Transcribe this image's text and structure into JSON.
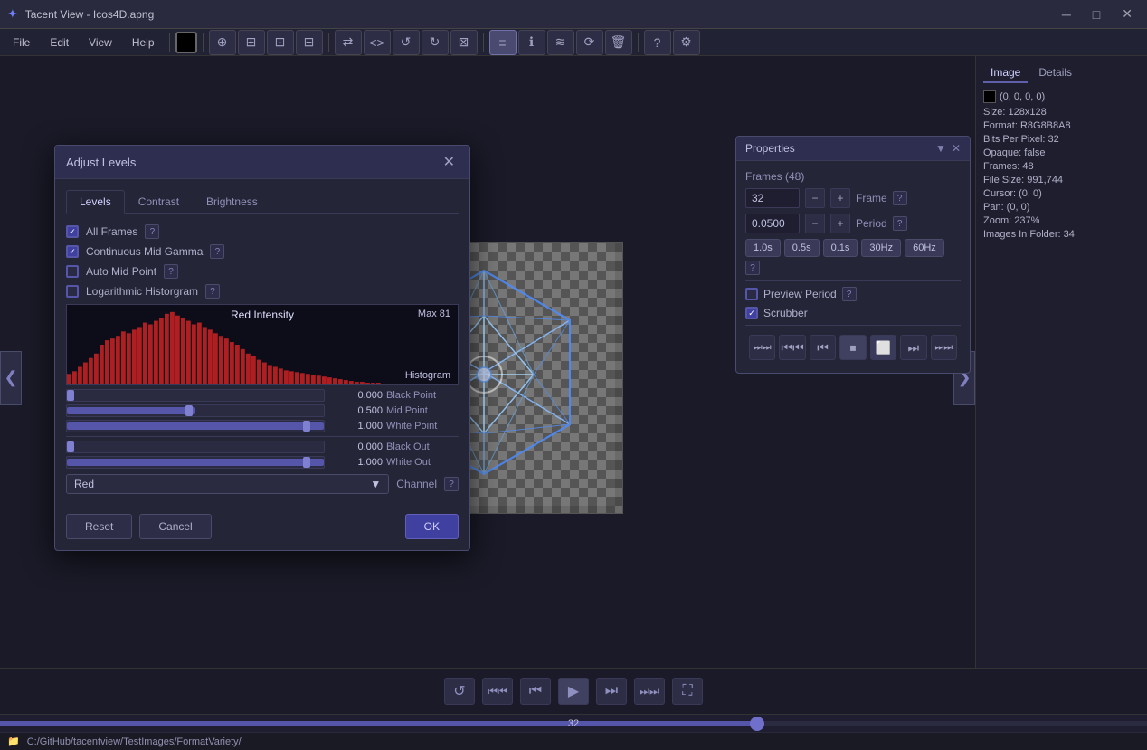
{
  "window": {
    "title": "Tacent View - Icos4D.apng",
    "minimize": "─",
    "maximize": "□",
    "close": "✕"
  },
  "menu": {
    "items": [
      "File",
      "Edit",
      "View",
      "Help"
    ]
  },
  "toolbar": {
    "color_btn": "#000000",
    "buttons": [
      "⊕",
      "⊞",
      "⊡",
      "⊟",
      "⇄",
      "<>",
      "↺",
      "↻",
      "⊠",
      "≡",
      "ℹ",
      "≋",
      "⟳",
      "🗑",
      "?",
      "⚙"
    ]
  },
  "dialog": {
    "title": "Adjust Levels",
    "tabs": [
      "Levels",
      "Contrast",
      "Brightness"
    ],
    "active_tab": "Levels",
    "checkboxes": [
      {
        "label": "All Frames",
        "checked": true,
        "has_help": true
      },
      {
        "label": "Continuous Mid Gamma",
        "checked": true,
        "has_help": true
      },
      {
        "label": "Auto Mid Point",
        "checked": false,
        "has_help": true
      },
      {
        "label": "Logarithmic Historgram",
        "checked": false,
        "has_help": true
      }
    ],
    "histogram": {
      "label": "Red Intensity",
      "max_label": "Max 81",
      "type_label": "Histogram"
    },
    "levels": [
      {
        "value": "0.000",
        "label": "Black Point"
      },
      {
        "value": "0.500",
        "label": "Mid Point"
      },
      {
        "value": "1.000",
        "label": "White Point"
      },
      {
        "value": "0.000",
        "label": "Black Out"
      },
      {
        "value": "1.000",
        "label": "White Out"
      }
    ],
    "channel": {
      "selected": "Red",
      "label": "Channel",
      "has_help": true
    },
    "buttons": {
      "reset": "Reset",
      "cancel": "Cancel",
      "ok": "OK"
    }
  },
  "properties": {
    "title": "Properties",
    "frames_label": "Frames (48)",
    "frame_value": "32",
    "period_value": "0.0500",
    "frame_label": "Frame",
    "period_label": "Period",
    "speed_buttons": [
      "1.0s",
      "0.5s",
      "0.1s",
      "30Hz",
      "60Hz"
    ],
    "active_speed": null,
    "preview_period": {
      "label": "Preview Period",
      "checked": false
    },
    "scrubber": {
      "label": "Scrubber",
      "checked": true
    },
    "transport": [
      "⏭",
      "⏮",
      "⏮",
      "⏹",
      "⏹",
      "⏭",
      "⏭"
    ]
  },
  "info_panel": {
    "tabs": [
      "Image",
      "Details"
    ],
    "active_tab": "Image",
    "color_value": "(0, 0, 0, 0)",
    "size": "Size: 128x128",
    "format": "Format: R8G8B8A8",
    "bpp": "Bits Per Pixel: 32",
    "opaque": "Opaque: false",
    "frames": "Frames: 48",
    "filesize": "File Size: 991,744",
    "cursor": "Cursor: (0, 0)",
    "pan": "Pan: (0, 0)",
    "zoom": "Zoom: 237%",
    "images_in_folder": "Images In Folder: 34"
  },
  "playback": {
    "frame": "32",
    "transport_buttons": [
      "↺",
      "⏮⏮",
      "⏮",
      "▶",
      "⏭",
      "⏭⏭",
      "⛶"
    ]
  },
  "filepath": {
    "icon": "📁",
    "path": "C:/GitHub/tacentview/TestImages/FormatVariety/"
  },
  "progress": {
    "value": 32,
    "max": 48,
    "thumb_pct": 66
  }
}
